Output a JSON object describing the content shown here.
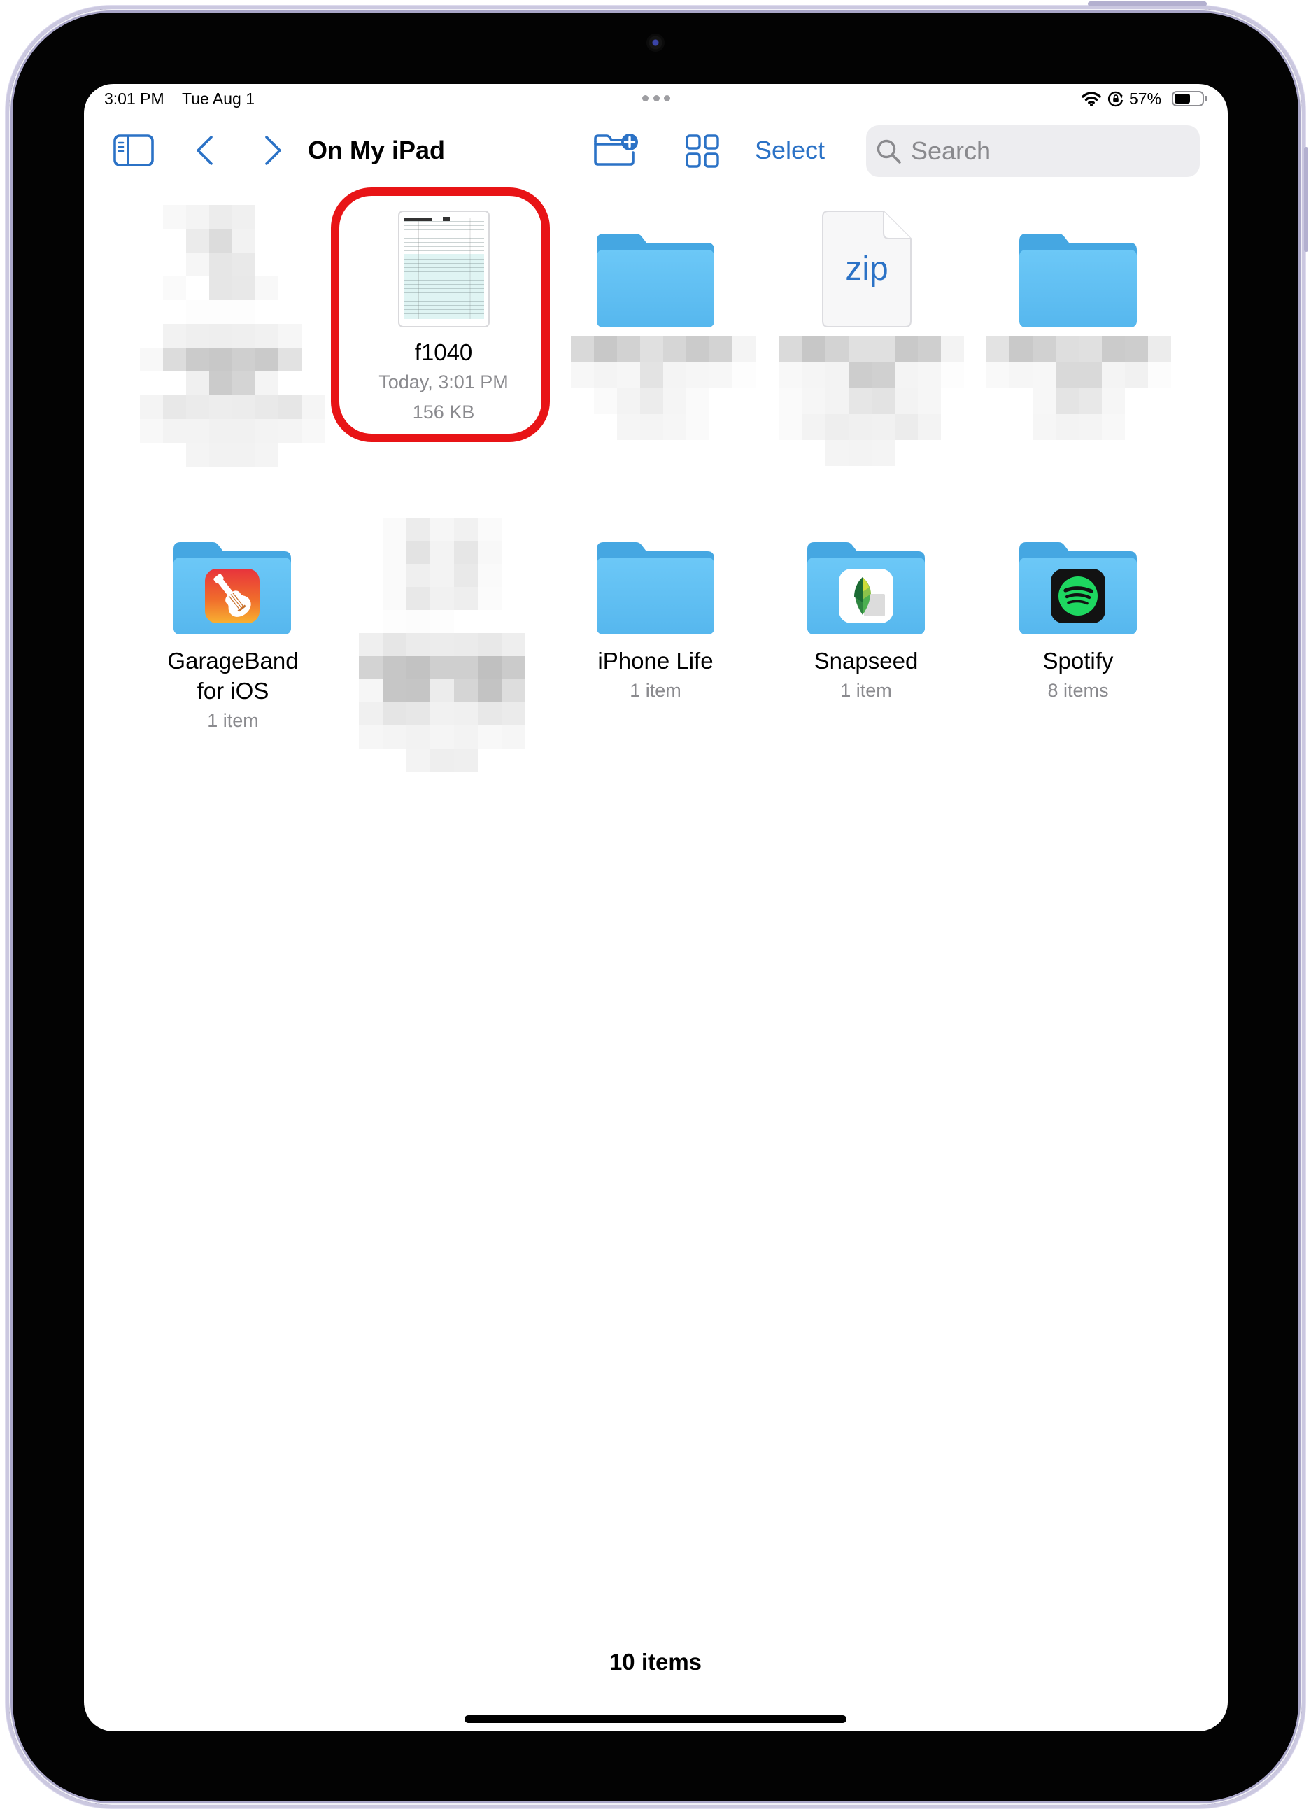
{
  "status_bar": {
    "time": "3:01 PM",
    "date": "Tue Aug 1",
    "battery_percent_label": "57%",
    "battery_level_percent": 57,
    "icons": [
      "wifi-icon",
      "orientation-lock-icon",
      "battery-icon"
    ]
  },
  "multitasking": {
    "icon": "ellipsis-icon"
  },
  "toolbar": {
    "title": "On My iPad",
    "select_label": "Select",
    "search": {
      "placeholder": "Search"
    },
    "icons": {
      "sidebar": "sidebar-toggle-icon",
      "back": "chevron-left-icon",
      "forward": "chevron-right-icon",
      "new_folder": "new-folder-icon",
      "view_mode": "grid-view-icon",
      "search": "magnifier-icon",
      "dictation": "microphone-icon"
    }
  },
  "items": [
    {
      "kind": "redacted",
      "redacted": true
    },
    {
      "kind": "document",
      "name": "f1040",
      "modified": "Today, 3:01 PM",
      "size": "156 KB",
      "highlighted": true,
      "icon": "pdf-thumbnail"
    },
    {
      "kind": "folder",
      "name_redacted": true,
      "icon": "folder-icon"
    },
    {
      "kind": "zip",
      "icon_label": "zip",
      "name_redacted": true,
      "icon": "zip-file-icon"
    },
    {
      "kind": "folder",
      "name_redacted": true,
      "icon": "folder-icon"
    },
    {
      "kind": "folder",
      "name_lines": [
        "GarageBand",
        "for iOS"
      ],
      "count": "1 item",
      "icon": "folder-icon",
      "app_icon": "garageband-icon"
    },
    {
      "kind": "redacted",
      "redacted": true
    },
    {
      "kind": "folder",
      "name": "iPhone Life",
      "count": "1 item",
      "icon": "folder-icon"
    },
    {
      "kind": "folder",
      "name": "Snapseed",
      "count": "1 item",
      "icon": "folder-icon",
      "app_icon": "snapseed-icon"
    },
    {
      "kind": "folder",
      "name": "Spotify",
      "count": "8 items",
      "icon": "folder-icon",
      "app_icon": "spotify-icon"
    }
  ],
  "footer": {
    "item_count": "10 items"
  },
  "colors": {
    "accent": "#2b72c6",
    "highlight": "#e81416",
    "secondary_text": "#8a8a8e",
    "folder_tab": "#45a7e2",
    "folder_body_top": "#6cc8f7",
    "folder_body_bottom": "#56b7ee",
    "search_background": "#ededf0"
  }
}
